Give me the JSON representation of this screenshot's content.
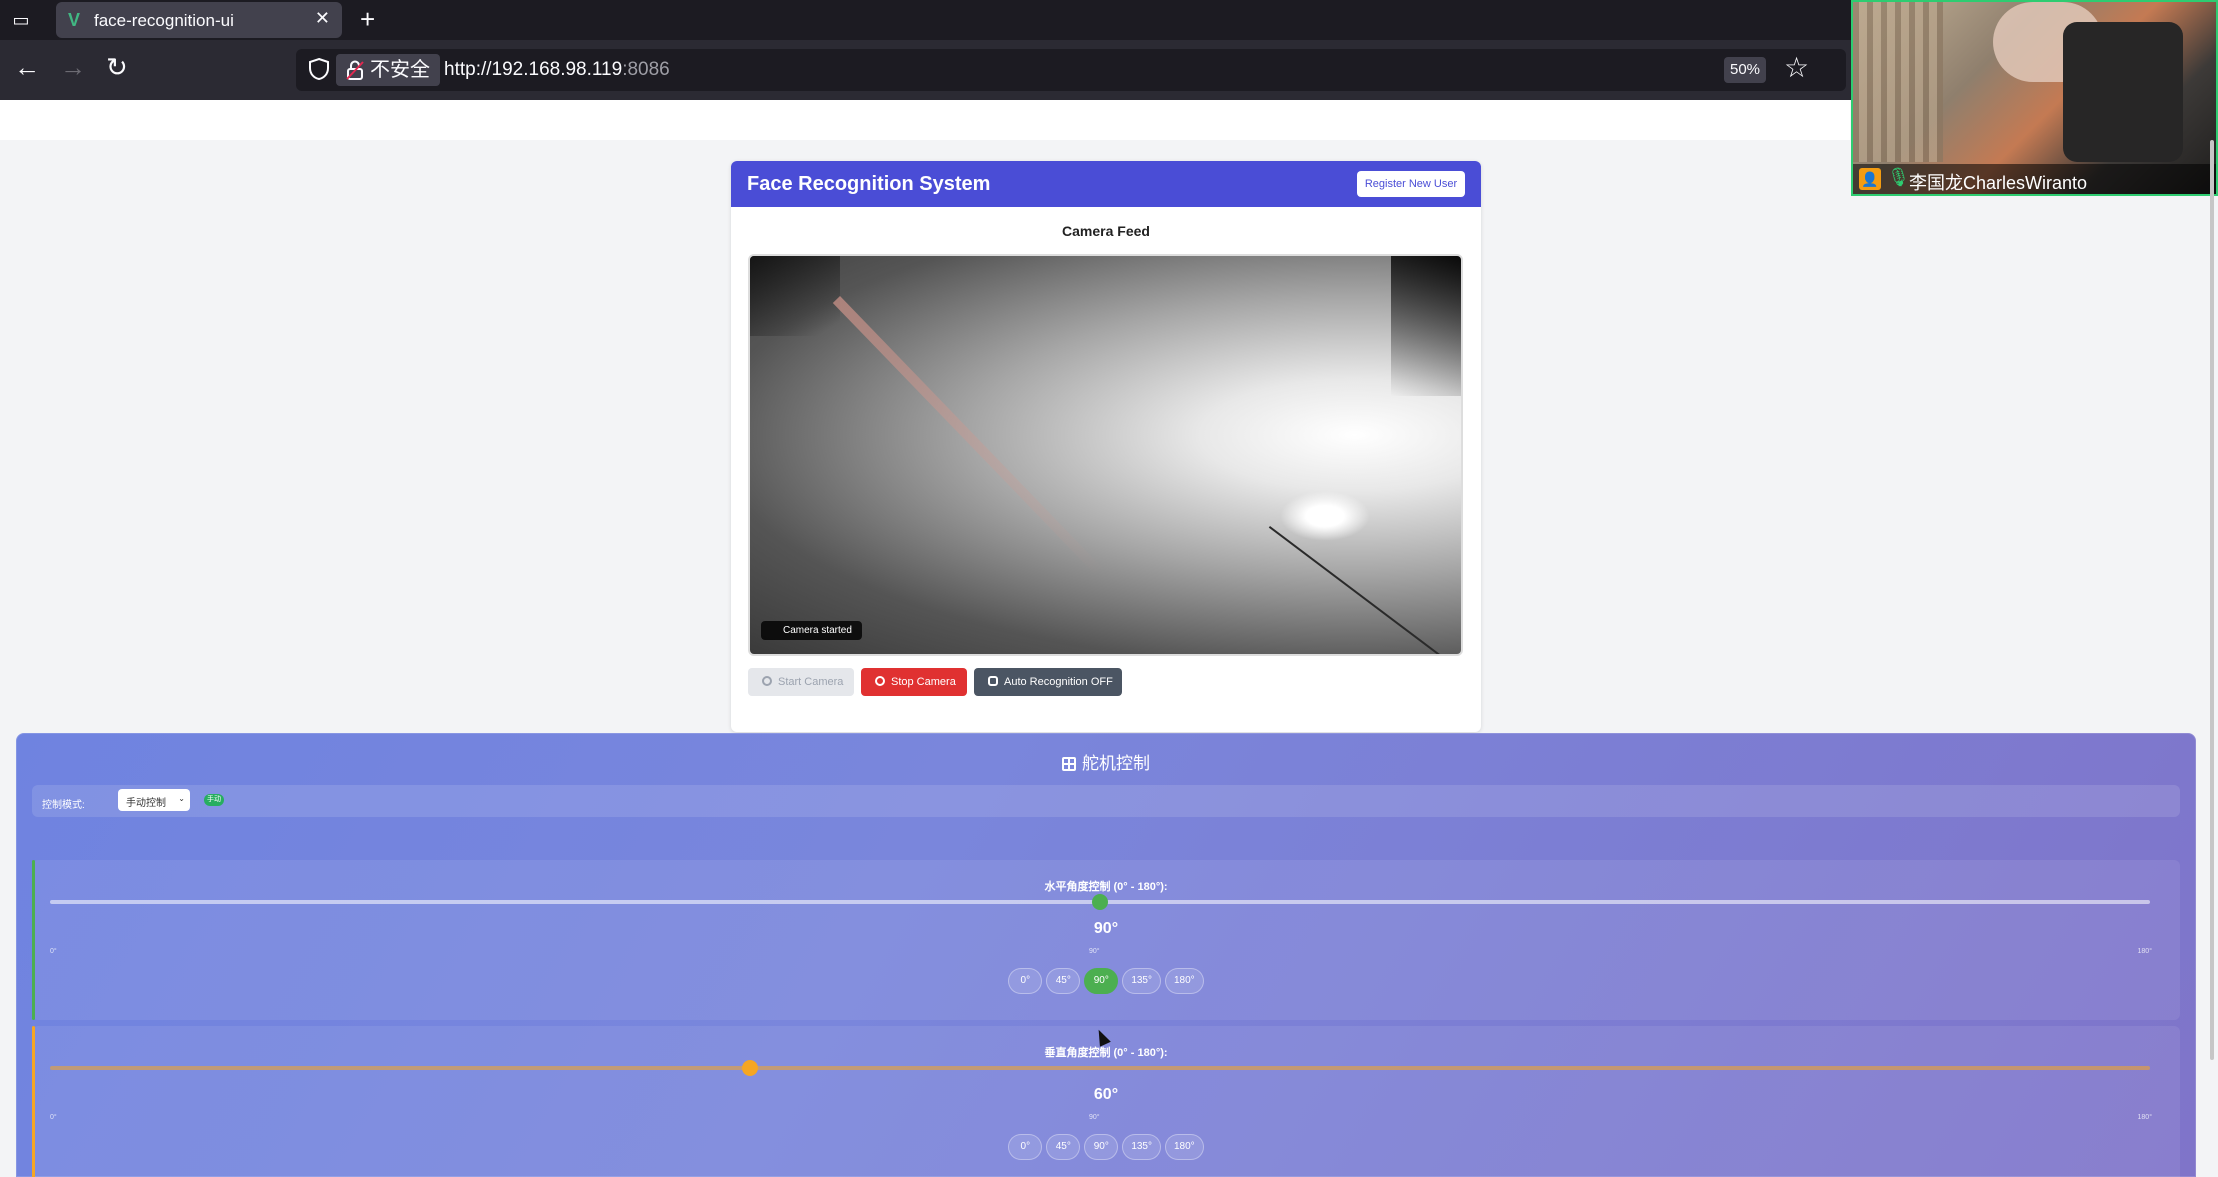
{
  "browser": {
    "tab_title": "face-recognition-ui",
    "security_label": "不安全",
    "url_host": "http://192.168.98.119",
    "url_port": ":8086",
    "zoom": "50%"
  },
  "call_overlay": {
    "participant_name": "李国龙CharlesWiranto"
  },
  "app": {
    "title": "Face Recognition System",
    "register_button": "Register New User",
    "feed_label": "Camera Feed",
    "camera_status": "Camera started",
    "buttons": {
      "start": "Start Camera",
      "stop": "Stop Camera",
      "auto": "Auto Recognition OFF"
    }
  },
  "servo": {
    "title": "舵机控制",
    "mode_label": "控制模式:",
    "mode_value": "手动控制",
    "mode_badge": "手动",
    "horizontal": {
      "label": "水平角度控制 (0° - 180°):",
      "value_text": "90°",
      "value": 90,
      "min_label": "0°",
      "mid_label": "90°",
      "max_label": "180°",
      "presets": [
        "0°",
        "45°",
        "90°",
        "135°",
        "180°"
      ],
      "active_preset": 2,
      "accent_color": "#4caf50"
    },
    "vertical": {
      "label": "垂直角度控制 (0° - 180°):",
      "value_text": "60°",
      "value": 60,
      "min_label": "0°",
      "mid_label": "90°",
      "max_label": "180°",
      "presets": [
        "0°",
        "45°",
        "90°",
        "135°",
        "180°"
      ],
      "active_preset": -1,
      "accent_color": "#f5a623"
    }
  }
}
